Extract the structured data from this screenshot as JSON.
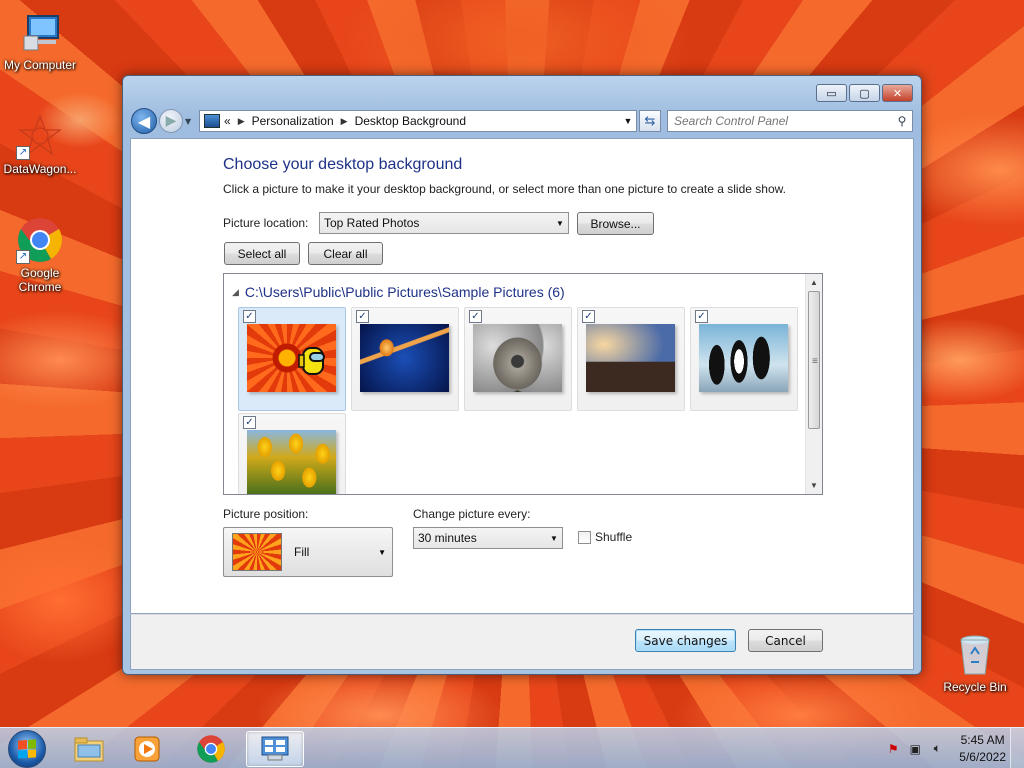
{
  "desktop": {
    "icons": [
      {
        "label": "My Computer",
        "icon": "computer-icon"
      },
      {
        "label": "DataWagon...",
        "icon": "datawagon-icon"
      },
      {
        "label": "Google\nChrome",
        "icon": "chrome-icon"
      },
      {
        "label": "Recycle Bin",
        "icon": "recycle-bin-icon"
      }
    ]
  },
  "window": {
    "controls": {
      "minimize": "▭",
      "maximize": "▢",
      "close": "✕"
    },
    "address": {
      "prefix": "«",
      "crumbs": [
        "Personalization",
        "Desktop Background"
      ]
    },
    "search": {
      "placeholder": "Search Control Panel"
    },
    "page": {
      "title": "Choose your desktop background",
      "description": "Click a picture to make it your desktop background, or select more than one picture to create a slide show.",
      "picture_location_label": "Picture location:",
      "picture_location_value": "Top Rated Photos",
      "browse_label": "Browse...",
      "select_all_label": "Select all",
      "clear_all_label": "Clear all",
      "group_header": "C:\\Users\\Public\\Public Pictures\\Sample Pictures (6)",
      "thumbnails": [
        {
          "name": "flower",
          "checked": true,
          "selected": true
        },
        {
          "name": "jellyfish",
          "checked": true,
          "selected": false
        },
        {
          "name": "koala",
          "checked": true,
          "selected": false
        },
        {
          "name": "lighthouse",
          "checked": true,
          "selected": false
        },
        {
          "name": "penguins",
          "checked": true,
          "selected": false
        },
        {
          "name": "tulips",
          "checked": true,
          "selected": false
        }
      ],
      "picture_position_label": "Picture position:",
      "picture_position_value": "Fill",
      "change_every_label": "Change picture every:",
      "change_every_value": "30 minutes",
      "shuffle_label": "Shuffle",
      "shuffle_checked": false
    },
    "footer": {
      "save_label": "Save changes",
      "cancel_label": "Cancel"
    }
  },
  "taskbar": {
    "apps": [
      "explorer-icon",
      "media-player-icon",
      "chrome-icon",
      "control-panel-icon"
    ],
    "active_app": "control-panel-icon",
    "clock": {
      "time": "5:45 AM",
      "date": "5/6/2022"
    }
  },
  "colors": {
    "title_blue": "#1e3287",
    "taskbar": "#a6c0df"
  }
}
